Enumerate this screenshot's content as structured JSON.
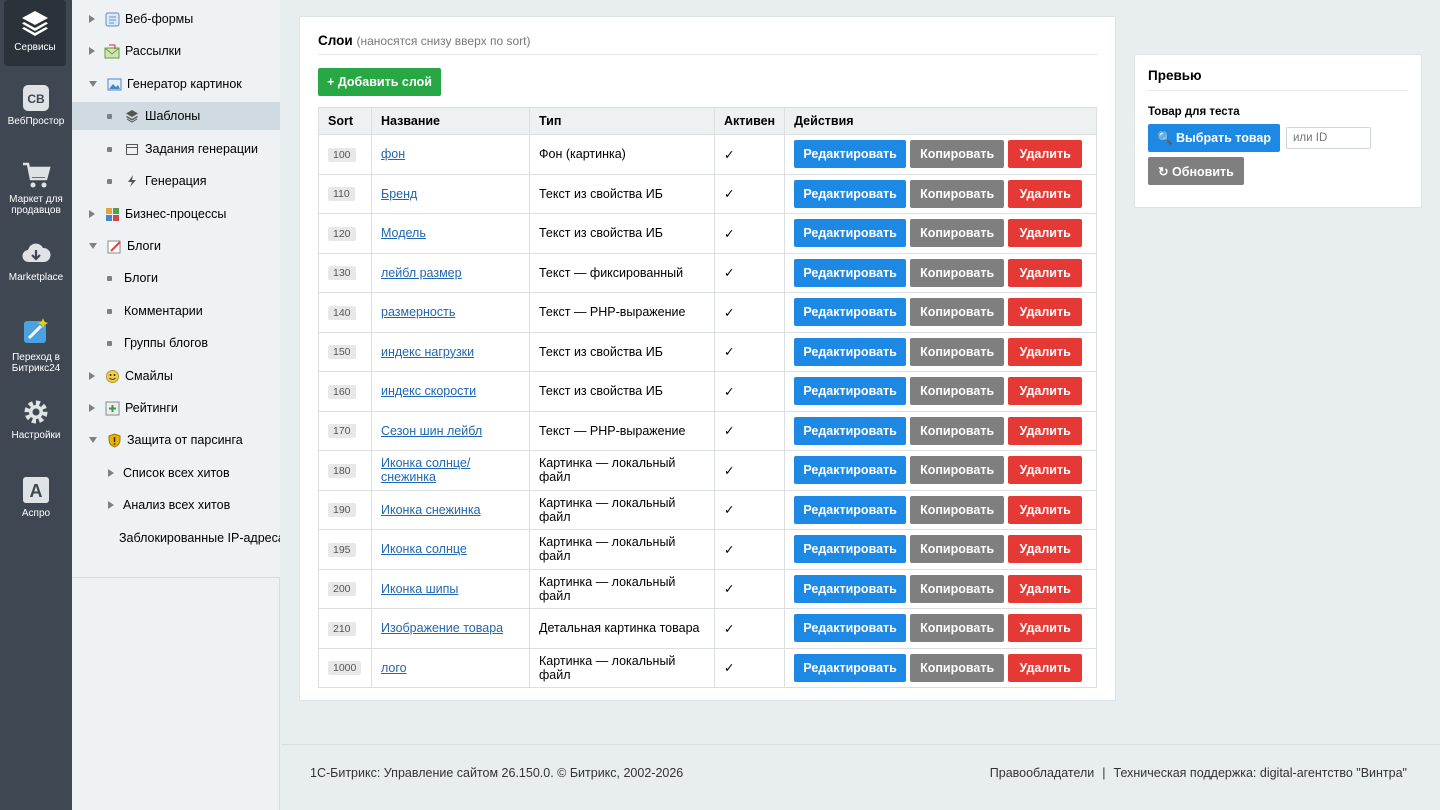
{
  "leftbar": {
    "items": [
      {
        "label": "Сервисы",
        "icon": "layers-icon"
      },
      {
        "label": "ВебПростор",
        "icon": "webprostor-icon"
      },
      {
        "label": "Маркет для продавцов",
        "icon": "cart-icon"
      },
      {
        "label": "Marketplace",
        "icon": "cloud-download-icon"
      },
      {
        "label": "Переход в Битрикс24",
        "icon": "wand-icon"
      },
      {
        "label": "Настройки",
        "icon": "gear-icon"
      },
      {
        "label": "Аспро",
        "icon": "aspro-icon"
      }
    ]
  },
  "menu": {
    "items": [
      {
        "label": "Веб-формы",
        "icon": "form-icon"
      },
      {
        "label": "Рассылки",
        "icon": "mail-icon"
      },
      {
        "label": "Генератор картинок",
        "icon": "image-icon"
      },
      {
        "label": "Шаблоны",
        "icon": "layers-small-icon"
      },
      {
        "label": "Задания генерации",
        "icon": "calendar-icon"
      },
      {
        "label": "Генерация",
        "icon": "lightning-icon"
      },
      {
        "label": "Бизнес-процессы",
        "icon": "process-icon"
      },
      {
        "label": "Блоги",
        "icon": "blog-icon"
      },
      {
        "label": "Блоги"
      },
      {
        "label": "Комментарии"
      },
      {
        "label": "Группы блогов"
      },
      {
        "label": "Смайлы",
        "icon": "smile-icon"
      },
      {
        "label": "Рейтинги",
        "icon": "rating-icon"
      },
      {
        "label": "Защита от парсинга",
        "icon": "shield-icon"
      },
      {
        "label": "Список всех хитов"
      },
      {
        "label": "Анализ всех хитов"
      },
      {
        "label": "Заблокированные IP-адреса"
      }
    ]
  },
  "panel": {
    "title": "Слои",
    "subtitle": "(наносятся снизу вверх по sort)",
    "add_button": "+ Добавить слой",
    "headers": [
      "Sort",
      "Название",
      "Тип",
      "Активен",
      "Действия"
    ],
    "edit_label": "Редактировать",
    "copy_label": "Копировать",
    "delete_label": "Удалить",
    "rows": [
      {
        "sort": "100",
        "name": "фон",
        "type": "Фон (картинка)",
        "active": "✓"
      },
      {
        "sort": "110",
        "name": "Бренд",
        "type": "Текст из свойства ИБ",
        "active": "✓"
      },
      {
        "sort": "120",
        "name": "Модель",
        "type": "Текст из свойства ИБ",
        "active": "✓"
      },
      {
        "sort": "130",
        "name": "лейбл размер",
        "type": "Текст — фиксированный",
        "active": "✓"
      },
      {
        "sort": "140",
        "name": "размерность",
        "type": "Текст — PHP-выражение",
        "active": "✓"
      },
      {
        "sort": "150",
        "name": "индекс нагрузки",
        "type": "Текст из свойства ИБ",
        "active": "✓"
      },
      {
        "sort": "160",
        "name": "индекс скорости",
        "type": "Текст из свойства ИБ",
        "active": "✓"
      },
      {
        "sort": "170",
        "name": "Сезон шин лейбл",
        "type": "Текст — PHP-выражение",
        "active": "✓"
      },
      {
        "sort": "180",
        "name": "Иконка солнце/снежинка",
        "type": "Картинка — локальный файл",
        "active": "✓"
      },
      {
        "sort": "190",
        "name": "Иконка снежинка",
        "type": "Картинка — локальный файл",
        "active": "✓"
      },
      {
        "sort": "195",
        "name": "Иконка солнце",
        "type": "Картинка — локальный файл",
        "active": "✓"
      },
      {
        "sort": "200",
        "name": "Иконка шипы",
        "type": "Картинка — локальный файл",
        "active": "✓"
      },
      {
        "sort": "210",
        "name": "Изображение товара",
        "type": "Детальная картинка товара",
        "active": "✓"
      },
      {
        "sort": "1000",
        "name": "лого",
        "type": "Картинка — локальный файл",
        "active": "✓"
      }
    ]
  },
  "preview": {
    "title": "Превью",
    "label": "Товар для теста",
    "choose_button": "🔍 Выбрать товар",
    "id_placeholder": "или ID",
    "refresh_button": "↻ Обновить"
  },
  "footer": {
    "left": "1С-Битрикс: Управление сайтом 26.150.0. © Битрикс, 2002-2026",
    "rights": "Правообладатели",
    "separator": "|",
    "support": "Техническая поддержка: digital-агентство \"Винтра\""
  }
}
